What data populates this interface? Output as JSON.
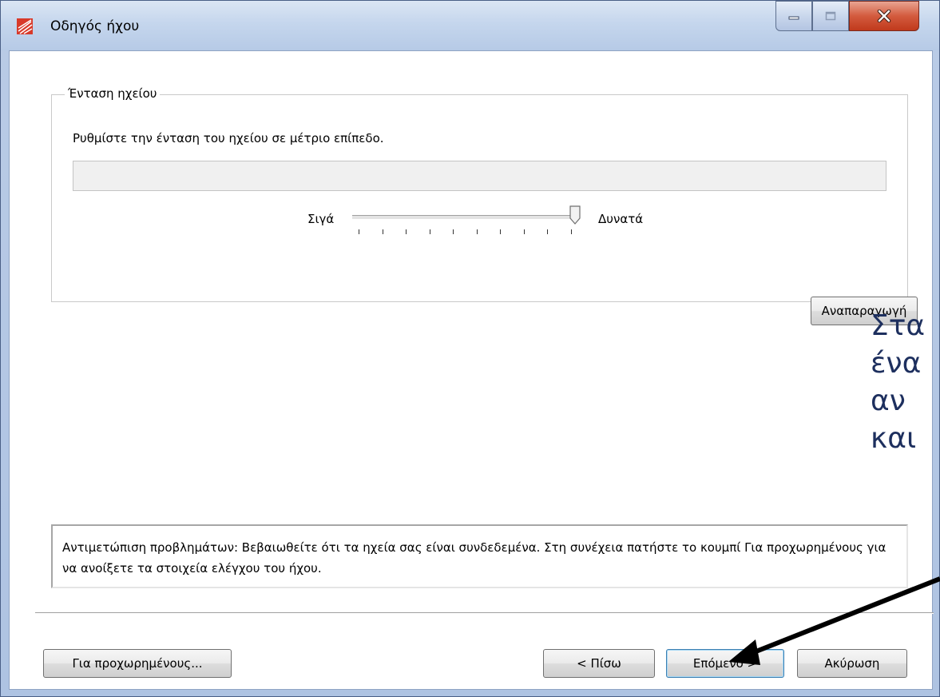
{
  "window": {
    "title": "Οδηγός ήχου"
  },
  "group": {
    "label": "Ένταση ηχείου",
    "instruction": "Ρυθμίστε την ένταση του ηχείου σε μέτριο επίπεδο.",
    "slider": {
      "low_label": "Σιγά",
      "high_label": "Δυνατά",
      "value_fraction": 1.0,
      "tick_count": 10
    },
    "play_label": "Αναπαραγωγή"
  },
  "troubleshoot": {
    "text": "Αντιμετώπιση προβλημάτων: Βεβαιωθείτε ότι τα ηχεία σας είναι συνδεδεμένα. Στη συνέχεια πατήστε το κουμπί Για προχωρημένους για να ανοίξετε τα στοιχεία ελέγχου του ήχου."
  },
  "buttons": {
    "advanced": "Για προχωρημένους...",
    "back": "< Πίσω",
    "next": "Επόμενο >",
    "cancel": "Ακύρωση"
  },
  "overlay": {
    "lines": [
      "Στα",
      "ένα",
      "αν",
      "και"
    ]
  },
  "colors": {
    "close_button": "#c0391c",
    "overlay_text": "#1d2f5e",
    "default_button_border": "#3c7fb1"
  },
  "icons": {
    "app": "speaker-wizard-icon",
    "minimize": "minimize-icon",
    "maximize": "maximize-icon",
    "close": "close-icon"
  }
}
